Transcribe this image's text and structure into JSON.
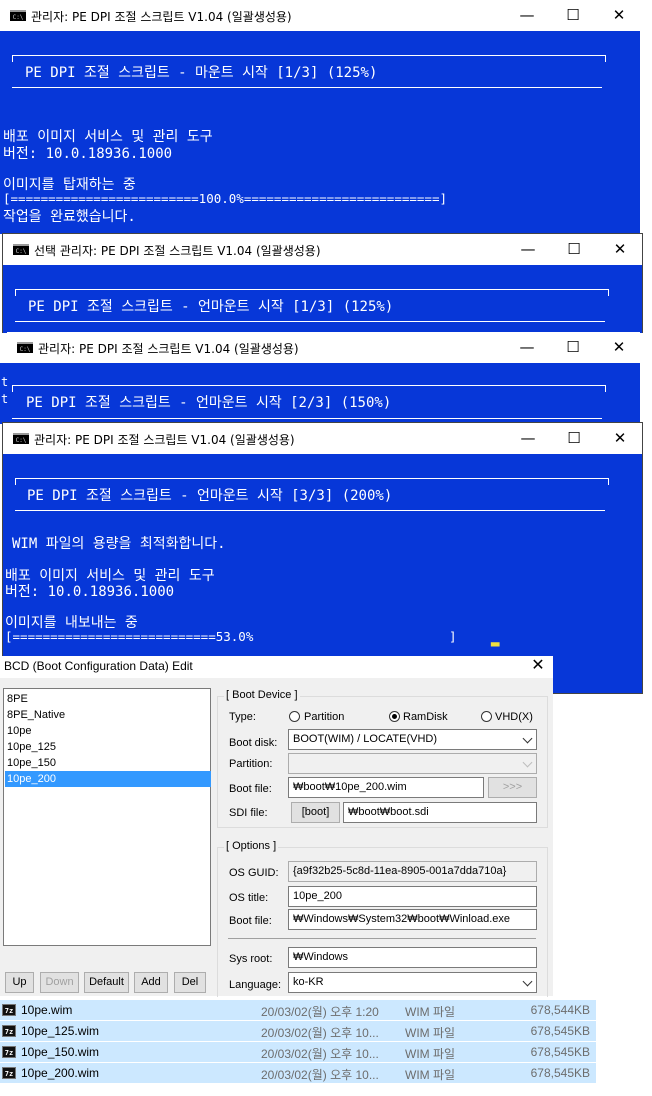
{
  "icons": {
    "console": "console-icon",
    "file": "7z-icon"
  },
  "colors": {
    "console_bg": "#0737d8",
    "selection": "#cce8ff",
    "list_selection": "#3399ff"
  },
  "window_controls": {
    "minimize": "—",
    "maximize": "☐",
    "close": "✕"
  },
  "windows": [
    {
      "title": "관리자:  PE DPI 조절 스크립트 V1.04 (일괄생성용)",
      "banner": "PE DPI 조절 스크립트 - 마운트 시작 [1/3] (125%)",
      "lines": [
        "배포 이미지 서비스 및 관리 도구",
        "버전: 10.0.18936.1000",
        "이미지를 탑재하는 중",
        "[=========================100.0%==========================]",
        "작업을 완료했습니다."
      ]
    },
    {
      "title": "선택 관리자:  PE DPI 조절 스크립트 V1.04 (일괄생성용)",
      "banner": "PE DPI 조절 스크립트 - 언마운트 시작 [1/3] (125%)"
    },
    {
      "title": "관리자:  PE DPI 조절 스크립트 V1.04 (일괄생성용)",
      "banner": "PE DPI 조절 스크립트 - 언마운트 시작 [2/3] (150%)",
      "side_chars": [
        "t",
        "t"
      ]
    },
    {
      "title": "관리자:  PE DPI 조절 스크립트 V1.04 (일괄생성용)",
      "banner": "PE DPI 조절 스크립트 - 언마운트 시작 [3/3] (200%)",
      "lines": [
        "WIM 파일의 용량을 최적화합니다.",
        "배포 이미지 서비스 및 관리 도구",
        "버전: 10.0.18936.1000",
        "이미지를 내보내는 중",
        "[===========================53.0%                          ]"
      ],
      "cursor": "▂"
    }
  ],
  "bcd": {
    "title": "BCD (Boot Configuration Data) Edit",
    "close": "✕",
    "entries": [
      "8PE",
      "8PE_Native",
      "10pe",
      "10pe_125",
      "10pe_150",
      "10pe_200"
    ],
    "selected": "10pe_200",
    "buttons": {
      "up": "Up",
      "down": "Down",
      "default": "Default",
      "add": "Add",
      "del": "Del"
    },
    "boot_device": {
      "group": "[ Boot Device ]",
      "type_label": "Type:",
      "types": [
        "Partition",
        "RamDisk",
        "VHD(X)"
      ],
      "type_selected": "RamDisk",
      "boot_disk_label": "Boot disk:",
      "boot_disk": "BOOT(WIM) / LOCATE(VHD)",
      "partition_label": "Partition:",
      "partition": "",
      "boot_file_label": "Boot file:",
      "boot_file": "₩boot₩10pe_200.wim",
      "browse": ">>>",
      "sdi_label": "SDI file:",
      "sdi_button": "[boot]",
      "sdi_file": "₩boot₩boot.sdi"
    },
    "options": {
      "group": "[ Options ]",
      "os_guid_label": "OS GUID:",
      "os_guid": "{a9f32b25-5c8d-11ea-8905-001a7dda710a}",
      "os_title_label": "OS title:",
      "os_title": "10pe_200",
      "boot_file_label": "Boot file:",
      "boot_file": "₩Windows₩System32₩boot₩Winload.exe",
      "sys_root_label": "Sys root:",
      "sys_root": "₩Windows",
      "language_label": "Language:",
      "language": "ko-KR"
    }
  },
  "files": [
    {
      "name": "10pe.wim",
      "date": "20/03/02(월) 오후 1:20",
      "type": "WIM 파일",
      "size": "678,544KB"
    },
    {
      "name": "10pe_125.wim",
      "date": "20/03/02(월) 오후 10...",
      "type": "WIM 파일",
      "size": "678,545KB"
    },
    {
      "name": "10pe_150.wim",
      "date": "20/03/02(월) 오후 10...",
      "type": "WIM 파일",
      "size": "678,545KB"
    },
    {
      "name": "10pe_200.wim",
      "date": "20/03/02(월) 오후 10...",
      "type": "WIM 파일",
      "size": "678,545KB"
    }
  ]
}
